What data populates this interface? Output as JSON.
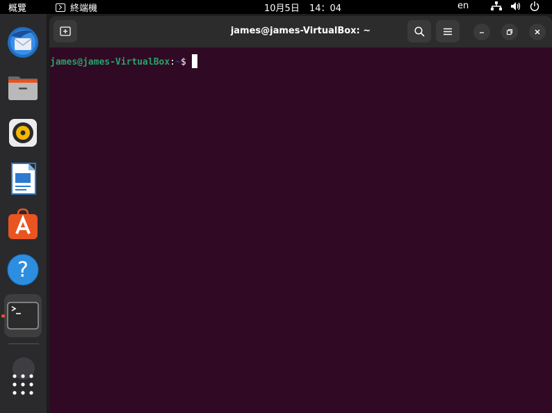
{
  "topbar": {
    "activities": "概覽",
    "app_name": "終端機",
    "date": "10月5日",
    "time": "14：04",
    "lang": "en",
    "tray_icons": [
      "network-icon",
      "volume-icon",
      "power-icon"
    ]
  },
  "dock": {
    "items": [
      {
        "name": "thunderbird",
        "icon": "mail-client-icon"
      },
      {
        "name": "files",
        "icon": "folder-icon"
      },
      {
        "name": "rhythmbox",
        "icon": "music-player-icon"
      },
      {
        "name": "libreoffice-writer",
        "icon": "document-writer-icon"
      },
      {
        "name": "ubuntu-software",
        "icon": "software-store-icon"
      },
      {
        "name": "help",
        "icon": "help-icon"
      },
      {
        "name": "terminal",
        "icon": "terminal-icon",
        "active": true
      }
    ],
    "show_apps_icon": "app-grid-icon",
    "accent": "#e95420"
  },
  "terminal": {
    "title": "james@james-VirtualBox: ~",
    "prompt": {
      "user_host": "james@james-VirtualBox",
      "separator": ":",
      "path": "~",
      "symbol": "$"
    },
    "colors": {
      "background": "#300a24",
      "prompt_user": "#26a269",
      "prompt_path": "#12488b",
      "text": "#ffffff"
    }
  }
}
